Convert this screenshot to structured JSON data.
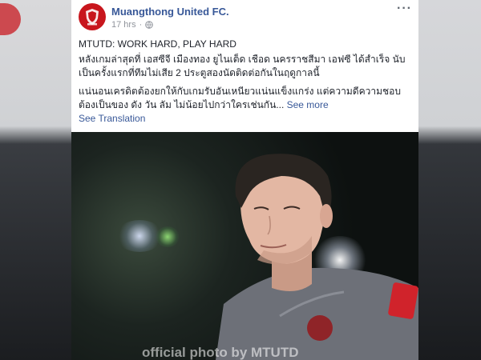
{
  "post": {
    "page_name": "Muangthong United FC.",
    "time": "17 hrs",
    "headline": "MTUTD: WORK HARD, PLAY HARD",
    "paragraph1": "หลังเกมล่าสุดที่ เอสซีจี เมืองทอง ยูไนเต็ด เชือด นครราชสีมา เอฟซี ได้สำเร็จ นับเป็นครั้งแรกที่ทีมไม่เสีย 2 ประตูสองนัดติดต่อกันในฤดูกาลนี้",
    "paragraph2": "แน่นอนเครดิตต้องยกให้กับเกมรับอันเหนียวแน่นแข็งแกร่ง แต่ความดีความชอบต้องเป็นของ ดัง วัน ลัม ไม่น้อยไปกว่าใครเช่นกัน...",
    "see_more": "See more",
    "see_translation": "See Translation",
    "more_options": "···",
    "photo_watermark": "official photo by MTUTD"
  },
  "icons": {
    "privacy": "globe-icon",
    "options": "ellipsis-icon",
    "avatar": "club-crest-logo"
  },
  "colors": {
    "link": "#385898",
    "text": "#1d2129",
    "meta": "#90949c",
    "brand_red": "#c8161d"
  }
}
